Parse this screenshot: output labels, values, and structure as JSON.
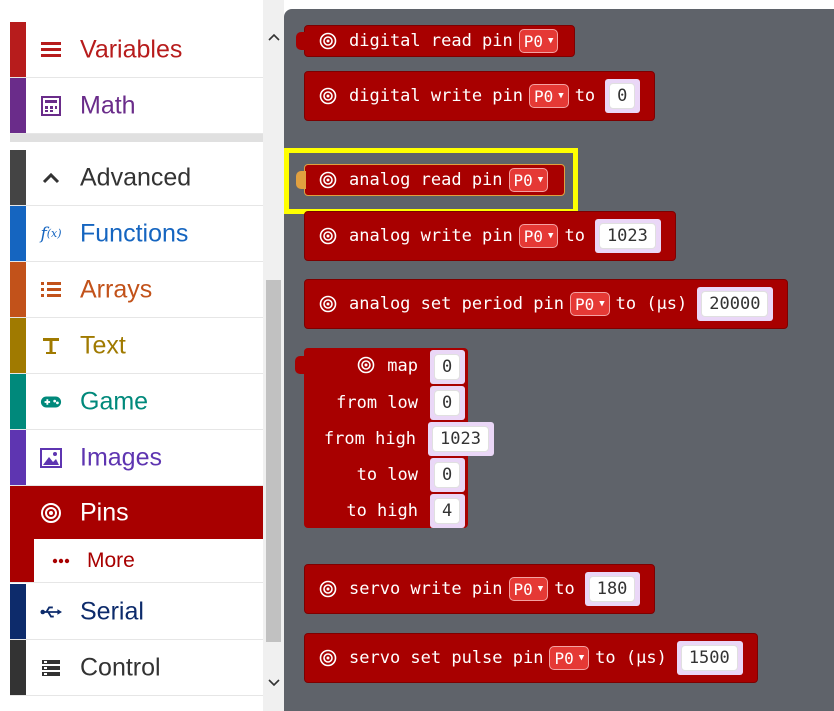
{
  "sidebar": {
    "categories": [
      {
        "label": "Variables",
        "color": "#b71c1c",
        "icon": "variables-icon"
      },
      {
        "label": "Math",
        "color": "#6a2c8a",
        "icon": "calculator-icon"
      },
      {
        "label": "Advanced",
        "color": "#444444",
        "icon": "chevron-up-icon"
      },
      {
        "label": "Functions",
        "color": "#1565c0",
        "icon": "function-icon"
      },
      {
        "label": "Arrays",
        "color": "#c2521a",
        "icon": "list-icon"
      },
      {
        "label": "Text",
        "color": "#a07a00",
        "icon": "text-icon"
      },
      {
        "label": "Game",
        "color": "#00897b",
        "icon": "gamepad-icon"
      },
      {
        "label": "Images",
        "color": "#5e35b1",
        "icon": "image-icon"
      },
      {
        "label": "Pins",
        "color": "#a80000",
        "icon": "pin-icon"
      },
      {
        "label": "More",
        "color": "#a80000",
        "icon": "more-dots-icon"
      },
      {
        "label": "Serial",
        "color": "#0d2b6b",
        "icon": "usb-icon"
      },
      {
        "label": "Control",
        "color": "#333333",
        "icon": "control-icon"
      }
    ]
  },
  "blocks": {
    "digital_read": {
      "text": "digital read pin",
      "pin": "P0"
    },
    "digital_write": {
      "text": "digital write pin",
      "pin": "P0",
      "to": "to",
      "value": "0"
    },
    "analog_read": {
      "text": "analog read pin",
      "pin": "P0"
    },
    "analog_write": {
      "text": "analog write pin",
      "pin": "P0",
      "to": "to",
      "value": "1023"
    },
    "analog_set_period": {
      "text": "analog set period pin",
      "pin": "P0",
      "to": "to (µs)",
      "value": "20000"
    },
    "map": {
      "rows": [
        {
          "label": "map",
          "value": "0"
        },
        {
          "label": "from low",
          "value": "0"
        },
        {
          "label": "from high",
          "value": "1023"
        },
        {
          "label": "to low",
          "value": "0"
        },
        {
          "label": "to high",
          "value": "4"
        }
      ]
    },
    "servo_write": {
      "text": "servo write pin",
      "pin": "P0",
      "to": "to",
      "value": "180"
    },
    "servo_pulse": {
      "text": "servo set pulse pin",
      "pin": "P0",
      "to": "to (µs)",
      "value": "1500"
    }
  },
  "colors": {
    "pins": "#a80000",
    "highlight": "#ffff00",
    "workspace": "#5f636a"
  }
}
